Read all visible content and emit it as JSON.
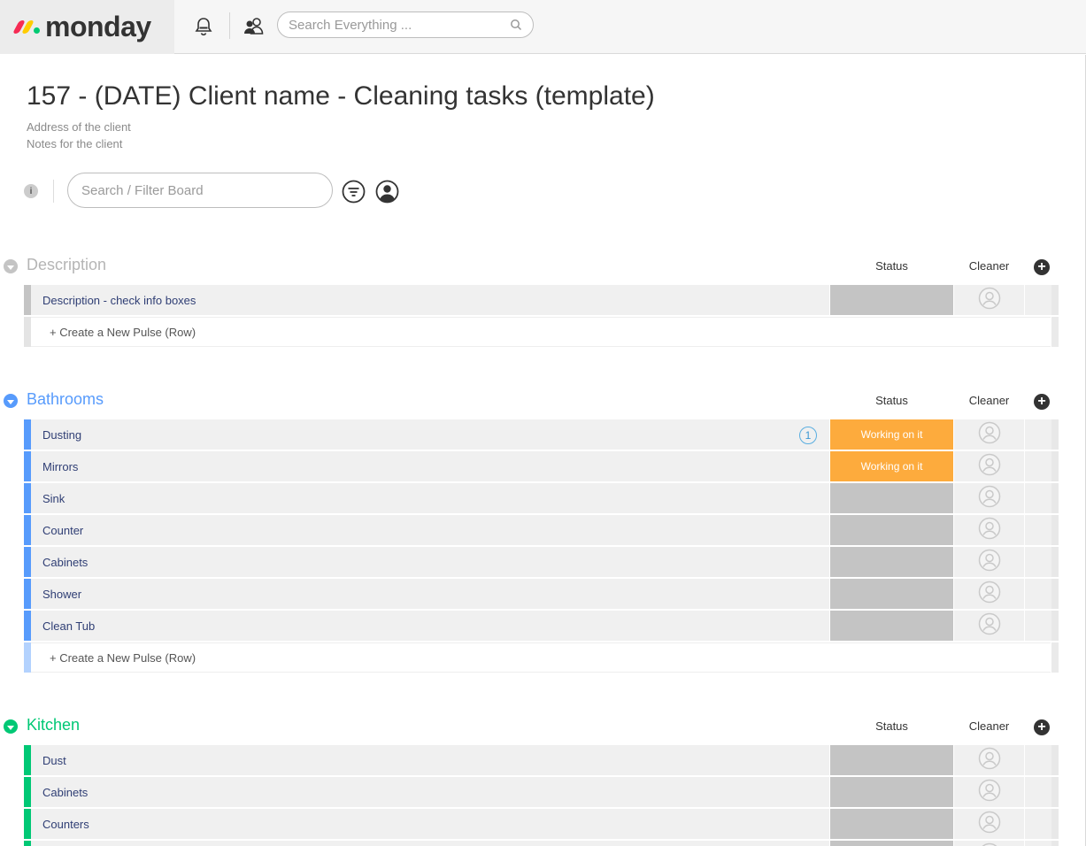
{
  "app": {
    "logo_text": "monday",
    "search_placeholder": "Search Everything ..."
  },
  "board": {
    "title": "157 - (DATE) Client name - Cleaning tasks (template)",
    "description_lines": [
      "Address of the client",
      "Notes for the client"
    ],
    "info_icon_text": "i",
    "filter_placeholder": "Search / Filter Board"
  },
  "columns": {
    "status": "Status",
    "cleaner": "Cleaner",
    "add": "+"
  },
  "new_row_label": "+ Create a New Pulse (Row)",
  "colors": {
    "status_working": "#fdab3d",
    "status_empty": "#c4c4c4",
    "logo_red": "#f62b54",
    "logo_yellow": "#ffcc00",
    "logo_green": "#00ca72"
  },
  "groups": [
    {
      "title": "Description",
      "color": "#c4c4c4",
      "title_color": "#b5b5b5",
      "rows": [
        {
          "name": "Description - check info boxes",
          "status": "",
          "updates": ""
        }
      ]
    },
    {
      "title": "Bathrooms",
      "color": "#579bfc",
      "title_color": "#579bfc",
      "rows": [
        {
          "name": "Dusting",
          "status": "Working on it",
          "updates": "1"
        },
        {
          "name": "Mirrors",
          "status": "Working on it",
          "updates": ""
        },
        {
          "name": "Sink",
          "status": "",
          "updates": ""
        },
        {
          "name": "Counter",
          "status": "",
          "updates": ""
        },
        {
          "name": "Cabinets",
          "status": "",
          "updates": ""
        },
        {
          "name": "Shower",
          "status": "",
          "updates": ""
        },
        {
          "name": "Clean Tub",
          "status": "",
          "updates": ""
        }
      ]
    },
    {
      "title": "Kitchen",
      "color": "#00c875",
      "title_color": "#00c875",
      "rows": [
        {
          "name": "Dust",
          "status": "",
          "updates": ""
        },
        {
          "name": "Cabinets",
          "status": "",
          "updates": ""
        },
        {
          "name": "Counters",
          "status": "",
          "updates": ""
        },
        {
          "name": "",
          "status": "",
          "updates": ""
        }
      ]
    }
  ]
}
